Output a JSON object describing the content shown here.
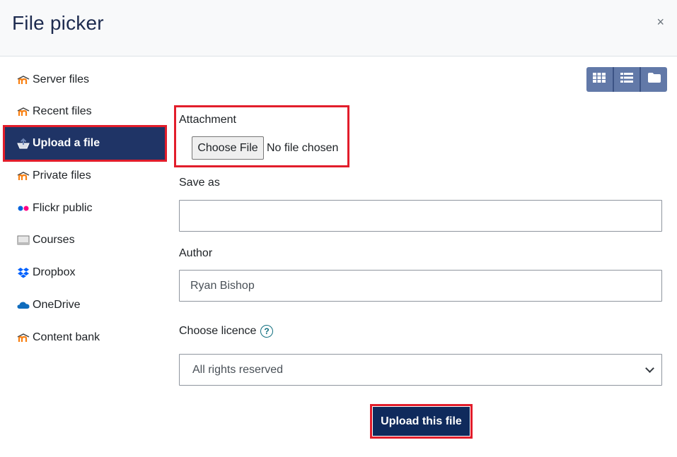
{
  "dialog": {
    "title": "File picker",
    "close_glyph": "×"
  },
  "sidebar": {
    "items": [
      {
        "label": "Server files",
        "icon": "moodle-icon",
        "active": false
      },
      {
        "label": "Recent files",
        "icon": "moodle-icon",
        "active": false
      },
      {
        "label": "Upload a file",
        "icon": "upload-icon",
        "active": true
      },
      {
        "label": "Private files",
        "icon": "moodle-icon",
        "active": false
      },
      {
        "label": "Flickr public",
        "icon": "flickr-icon",
        "active": false
      },
      {
        "label": "Courses",
        "icon": "courses-icon",
        "active": false
      },
      {
        "label": "Dropbox",
        "icon": "dropbox-icon",
        "active": false
      },
      {
        "label": "OneDrive",
        "icon": "onedrive-icon",
        "active": false
      },
      {
        "label": "Content bank",
        "icon": "moodle-icon",
        "active": false
      }
    ]
  },
  "view_toggle": {
    "buttons": [
      "grid-icon",
      "list-icon",
      "folder-icon"
    ]
  },
  "form": {
    "attachment_label": "Attachment",
    "choose_file_label": "Choose File",
    "no_file_text": "No file chosen",
    "save_as_label": "Save as",
    "save_as_value": "",
    "author_label": "Author",
    "author_value": "Ryan Bishop",
    "licence_label": "Choose licence",
    "help_glyph": "?",
    "licence_selected": "All rights reserved",
    "upload_button_label": "Upload this file"
  },
  "colors": {
    "accent": "#1f3466",
    "highlight": "#e21d2b",
    "toggle": "#6279a8",
    "moodle_orange": "#f98012"
  }
}
